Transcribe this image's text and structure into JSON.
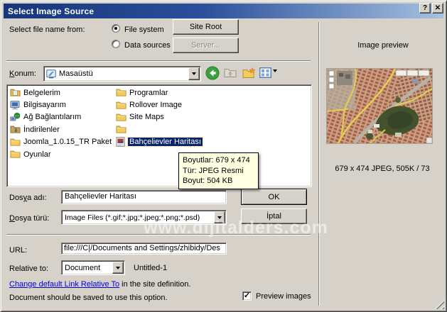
{
  "colors": {
    "titlebar_start": "#16367c",
    "titlebar_end": "#a6c1e0",
    "dialog_bg": "#d6d2c9",
    "selection_bg": "#0a246a",
    "tooltip_bg": "#ffffe1",
    "link_blue": "#0000e0"
  },
  "titlebar": {
    "title": "Select Image Source",
    "help_glyph": "?",
    "close_glyph": "✕"
  },
  "source": {
    "label": "Select file name from:",
    "file_system": "File system",
    "data_sources": "Data sources",
    "site_root": "Site Root",
    "server": "Server..."
  },
  "location": {
    "label_accel": "K",
    "label_post": "onum:",
    "value": "Masaüstü",
    "combo_icon": "desktop",
    "back_icon": "back",
    "up_icon": "up-folder",
    "new_folder_icon": "new-folder",
    "views_icon": "views"
  },
  "files": {
    "col1": [
      {
        "name": "Belgelerim",
        "icon": "my-documents"
      },
      {
        "name": "Bilgisayarım",
        "icon": "my-computer"
      },
      {
        "name": "Ağ Bağlantılarım",
        "icon": "network"
      },
      {
        "name": "İndirilenler",
        "icon": "download-folder"
      },
      {
        "name": "Joomla_1.0.15_TR Paket",
        "icon": "folder"
      },
      {
        "name": "Oyunlar",
        "icon": "folder"
      }
    ],
    "col2": [
      {
        "name": "Programlar",
        "icon": "folder"
      },
      {
        "name": "Rollover Image",
        "icon": "folder"
      },
      {
        "name": "Site Maps",
        "icon": "folder"
      },
      {
        "name": "",
        "icon": "folder"
      },
      {
        "name": "Bahçelievler Haritası",
        "icon": "image-file"
      }
    ]
  },
  "tooltip": {
    "line1": "Boyutlar: 679 x 474",
    "line2": "Tür: JPEG Resmi",
    "line3": "Boyut: 504 KB"
  },
  "form": {
    "file_name_pre": "Dos",
    "file_name_accel": "y",
    "file_name_post": "a adı:",
    "file_name_value": "Bahçelievler Haritası",
    "file_type_accel": "D",
    "file_type_post": "osya türü:",
    "file_type_value": "Image Files (*.gif;*.jpg;*.jpeg;*.png;*.psd)",
    "ok": "OK",
    "cancel": "İptal",
    "url_label": "URL:",
    "url_value": "file:///C|/Documents and Settings/zhibidy/Des",
    "relative_label": "Relative to:",
    "relative_value": "Document",
    "document_name": "Untitled-1"
  },
  "footer": {
    "link": "Change default Link Relative To",
    "link_rest": " in the site definition.",
    "note": "Document should be saved to use this option.",
    "preview_label": "Preview images",
    "check_glyph": "✓"
  },
  "preview": {
    "title": "Image preview",
    "caption": "679 x 474 JPEG, 505K / 73"
  },
  "watermark": "www.dijitalders.com"
}
